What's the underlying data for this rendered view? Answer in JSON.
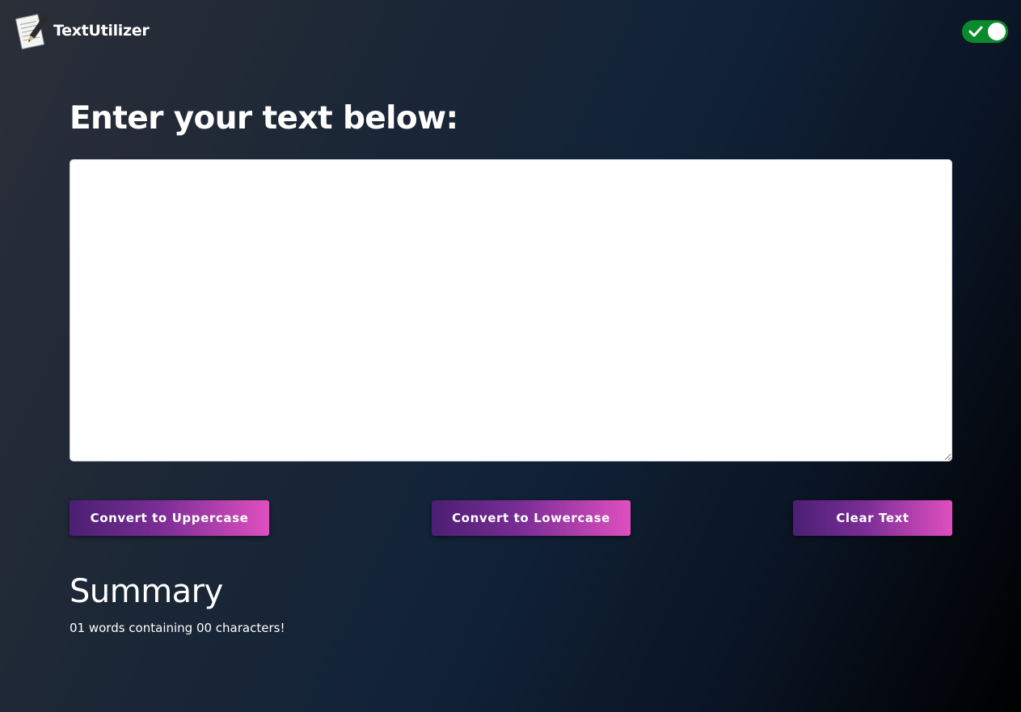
{
  "navbar": {
    "brand_name": "TextUtilizer",
    "logo_icon": "notepad-pencil-icon",
    "dark_mode_toggle": {
      "icon": "checkmark-icon",
      "state": "on",
      "color": "#0b8a2c"
    }
  },
  "main": {
    "heading": "Enter your text below:",
    "textarea": {
      "value": "",
      "placeholder": ""
    },
    "buttons": {
      "uppercase_label": "Convert to Uppercase",
      "lowercase_label": "Convert to Lowercase",
      "clear_label": "Clear Text"
    },
    "button_gradient": [
      "#4b1f73",
      "#e04fc0"
    ]
  },
  "summary": {
    "title": "Summary",
    "text": "01 words containing 00 characters!"
  },
  "colors": {
    "background_start": "#2b2f38",
    "background_end": "#000000",
    "text": "#ffffff"
  }
}
